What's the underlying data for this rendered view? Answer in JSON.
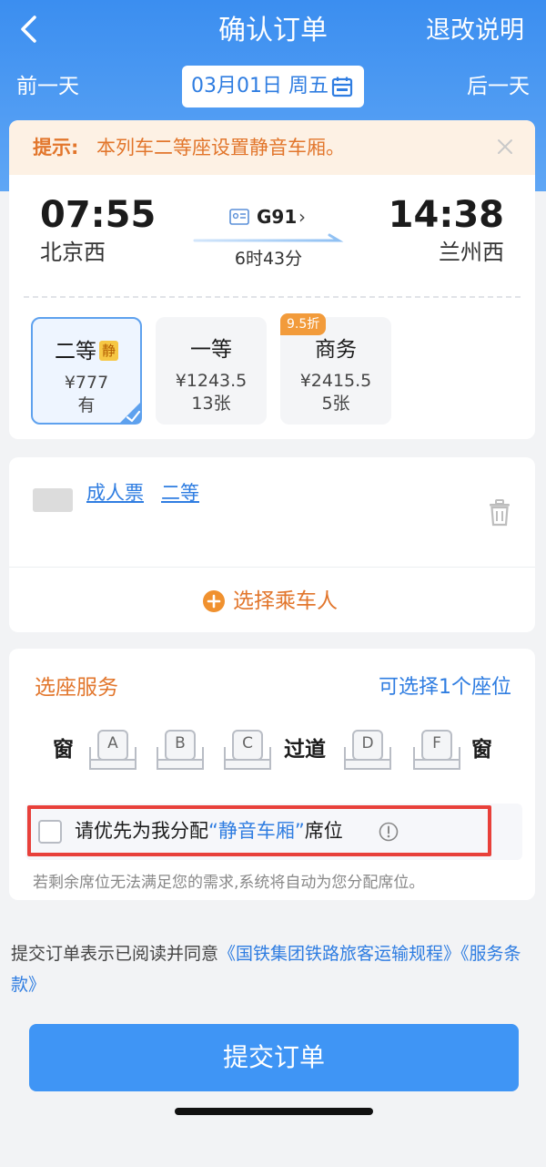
{
  "header": {
    "title": "确认订单",
    "refund_link": "退改说明",
    "prev_day": "前一天",
    "next_day": "后一天",
    "date": "03月01日 周五"
  },
  "tip": {
    "label": "提示:",
    "text": "本列车二等座设置静音车厢。"
  },
  "train": {
    "departure_time": "07:55",
    "departure_station": "北京西",
    "arrival_time": "14:38",
    "arrival_station": "兰州西",
    "train_no": "G91",
    "duration": "6时43分"
  },
  "seat_classes": [
    {
      "name": "二等",
      "badge": "静",
      "price": "¥777",
      "availability": "有",
      "selected": true
    },
    {
      "name": "一等",
      "price": "¥1243.5",
      "availability": "13张"
    },
    {
      "name": "商务",
      "price": "¥2415.5",
      "availability": "5张",
      "discount": "9.5折"
    }
  ],
  "passenger": {
    "ticket_type": "成人票",
    "seat_class": "二等",
    "add_label": "选择乘车人"
  },
  "seat_service": {
    "title": "选座服务",
    "hint": "可选择1个座位",
    "window_left": "窗",
    "window_right": "窗",
    "aisle": "过道",
    "seats": [
      "A",
      "B",
      "C",
      "D",
      "F"
    ],
    "quiet_prefix": "请优先为我分配",
    "quiet_highlight": "“静音车厢”",
    "quiet_suffix": "席位",
    "note": "若剩余席位无法满足您的需求,系统将自动为您分配席位。"
  },
  "agreement": {
    "prefix": "提交订单表示已阅读并同意",
    "link1": "《国铁集团铁路旅客运输规程》",
    "link2": "《服务条款》"
  },
  "submit_label": "提交订单",
  "colors": {
    "primary": "#3f95f5",
    "accent_orange": "#e2762c",
    "highlight_red": "#e8403a"
  }
}
